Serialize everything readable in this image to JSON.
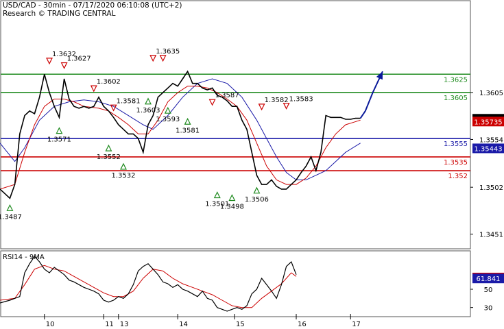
{
  "header": {
    "line1": "USD/CAD - 30min - 07/17/2020 06:10:08 (UTC+2)",
    "line2": "Research © TRADING CENTRAL"
  },
  "colors": {
    "price": "#000000",
    "ma_fast": "#cc0000",
    "ma_slow": "#1a1aa8",
    "support_green": "#1e8a1e",
    "level_blue": "#1a1aa8",
    "level_red": "#cc0000",
    "forecast_arrow": "#0a1a9a",
    "triangle_up": "#1e8a1e",
    "triangle_down": "#cc0000",
    "rsi_line": "#000000",
    "rsi_ma": "#cc0000"
  },
  "chart_data": [
    {
      "type": "line",
      "ylim": [
        1.3435,
        1.3705
      ],
      "y_ticks": [
        {
          "value": 1.3605,
          "label": "1.3605"
        },
        {
          "value": 1.3554,
          "label": "1.3554"
        },
        {
          "value": 1.3502,
          "label": "1.3502"
        },
        {
          "value": 1.3451,
          "label": "1.3451"
        }
      ],
      "x_ticks": [
        {
          "x": 18,
          "label": "10"
        },
        {
          "x": 42,
          "label": "11"
        },
        {
          "x": 48,
          "label": "13"
        },
        {
          "x": 72,
          "label": "14"
        },
        {
          "x": 95,
          "label": "15"
        },
        {
          "x": 120,
          "label": "16"
        },
        {
          "x": 142,
          "label": "17"
        }
      ],
      "xlim": [
        0,
        170
      ],
      "levels": [
        {
          "value": 1.3625,
          "label": "1.3625",
          "color": "#1e8a1e"
        },
        {
          "value": 1.3605,
          "label": "1.3605",
          "color": "#1e8a1e"
        },
        {
          "value": 1.3555,
          "label": "1.3555",
          "color": "#1a1aa8"
        },
        {
          "value": 1.3535,
          "label": "1.3535",
          "color": "#cc0000"
        },
        {
          "value": 1.352,
          "label": "1.352",
          "color": "#cc0000"
        }
      ],
      "price_tags": [
        {
          "value": 1.35765,
          "label": "1.35765",
          "bg": "#000000",
          "fg": "#ffffff"
        },
        {
          "value": 1.35735,
          "label": "1.35735",
          "bg": "#cc0000",
          "fg": "#ffffff"
        },
        {
          "value": 1.35443,
          "label": "1.35443",
          "bg": "#1a1aa8",
          "fg": "#ffffff"
        }
      ],
      "price_series": {
        "x": [
          0,
          2,
          4,
          6,
          8,
          10,
          12,
          14,
          16,
          18,
          20,
          22,
          24,
          26,
          28,
          30,
          32,
          34,
          36,
          38,
          40,
          42,
          44,
          46,
          48,
          50,
          52,
          54,
          56,
          58,
          60,
          62,
          64,
          66,
          68,
          70,
          72,
          74,
          76,
          78,
          80,
          82,
          84,
          86,
          88,
          90,
          92,
          94,
          96,
          98,
          100,
          102,
          104,
          106,
          108,
          110,
          112,
          114,
          116,
          118,
          120,
          122,
          124,
          126,
          128,
          130,
          132,
          134,
          136,
          138,
          140,
          142,
          144,
          146
        ],
        "y": [
          1.35,
          1.3495,
          1.349,
          1.3505,
          1.356,
          1.358,
          1.3585,
          1.3582,
          1.36,
          1.3625,
          1.3605,
          1.359,
          1.3578,
          1.362,
          1.3598,
          1.359,
          1.3588,
          1.359,
          1.3588,
          1.359,
          1.36,
          1.359,
          1.3585,
          1.3578,
          1.357,
          1.3565,
          1.356,
          1.356,
          1.3555,
          1.354,
          1.357,
          1.358,
          1.36,
          1.3605,
          1.361,
          1.3615,
          1.3612,
          1.362,
          1.3628,
          1.3615,
          1.3615,
          1.361,
          1.3608,
          1.361,
          1.3602,
          1.36,
          1.3596,
          1.359,
          1.359,
          1.3575,
          1.3565,
          1.354,
          1.3515,
          1.3505,
          1.3505,
          1.351,
          1.3503,
          1.35,
          1.35,
          1.3505,
          1.351,
          1.3518,
          1.3525,
          1.3535,
          1.352,
          1.354,
          1.358,
          1.3578,
          1.3578,
          1.3578,
          1.3576,
          1.3576,
          1.3577,
          1.3577
        ]
      },
      "ma_fast_series": {
        "name": "",
        "x": [
          0,
          6,
          10,
          14,
          18,
          22,
          26,
          30,
          34,
          40,
          44,
          48,
          52,
          56,
          60,
          64,
          68,
          72,
          76,
          80,
          84,
          88,
          92,
          96,
          100,
          104,
          108,
          112,
          116,
          120,
          124,
          128,
          132,
          136,
          140,
          146
        ],
        "y": [
          1.35,
          1.3505,
          1.354,
          1.357,
          1.359,
          1.3598,
          1.3598,
          1.3595,
          1.359,
          1.3588,
          1.3585,
          1.3578,
          1.357,
          1.356,
          1.356,
          1.3575,
          1.3595,
          1.3605,
          1.3612,
          1.3612,
          1.361,
          1.3605,
          1.3598,
          1.359,
          1.3575,
          1.355,
          1.3525,
          1.351,
          1.3505,
          1.3505,
          1.3512,
          1.3525,
          1.3545,
          1.356,
          1.357,
          1.3575
        ]
      },
      "ma_slow_series": {
        "name": "",
        "x": [
          0,
          6,
          10,
          16,
          22,
          28,
          34,
          40,
          46,
          52,
          58,
          62,
          68,
          74,
          80,
          86,
          92,
          98,
          104,
          108,
          112,
          116,
          120,
          124,
          128,
          132,
          136,
          140,
          146
        ],
        "y": [
          1.355,
          1.353,
          1.3545,
          1.3575,
          1.359,
          1.3595,
          1.3597,
          1.3595,
          1.359,
          1.358,
          1.357,
          1.3565,
          1.358,
          1.36,
          1.3615,
          1.362,
          1.3615,
          1.36,
          1.3575,
          1.3555,
          1.3535,
          1.3518,
          1.351,
          1.351,
          1.3515,
          1.352,
          1.353,
          1.354,
          1.355
        ]
      },
      "forecast_arrow": {
        "x": [
          146,
          148,
          151,
          155
        ],
        "y": [
          1.3577,
          1.3585,
          1.3605,
          1.3628
        ]
      },
      "annotations": [
        {
          "x": 4,
          "value": 1.3487,
          "label": "1.3487",
          "dir": "up"
        },
        {
          "x": 20,
          "value": 1.3632,
          "label": "1.3632",
          "dir": "down"
        },
        {
          "x": 26,
          "value": 1.3627,
          "label": "1.3627",
          "dir": "down"
        },
        {
          "x": 24,
          "value": 1.3571,
          "label": "1.3571",
          "dir": "up"
        },
        {
          "x": 38,
          "value": 1.3602,
          "label": "1.3602",
          "dir": "down"
        },
        {
          "x": 46,
          "value": 1.3581,
          "label": "1.3581",
          "dir": "down"
        },
        {
          "x": 44,
          "value": 1.3552,
          "label": "1.3552",
          "dir": "up"
        },
        {
          "x": 50,
          "value": 1.3532,
          "label": "1.3532",
          "dir": "up"
        },
        {
          "x": 62,
          "value": 1.3635,
          "label": "1.3635",
          "dir": "down"
        },
        {
          "x": 66,
          "value": 1.3635,
          "label": "",
          "dir": "down"
        },
        {
          "x": 60,
          "value": 1.3603,
          "label": "1.3603",
          "dir": "up"
        },
        {
          "x": 68,
          "value": 1.3593,
          "label": "1.3593",
          "dir": "up"
        },
        {
          "x": 76,
          "value": 1.3581,
          "label": "1.3581",
          "dir": "up"
        },
        {
          "x": 86,
          "value": 1.3587,
          "label": "1.3587",
          "dir": "down"
        },
        {
          "x": 88,
          "value": 1.3501,
          "label": "1.3501",
          "dir": "up"
        },
        {
          "x": 94,
          "value": 1.3498,
          "label": "1.3498",
          "dir": "up"
        },
        {
          "x": 104,
          "value": 1.3506,
          "label": "1.3506",
          "dir": "up"
        },
        {
          "x": 106,
          "value": 1.3582,
          "label": "1.3582",
          "dir": "down"
        },
        {
          "x": 116,
          "value": 1.3583,
          "label": "1.3583",
          "dir": "down"
        }
      ]
    },
    {
      "type": "line",
      "title": "RSI14 - 9MA",
      "ylim": [
        20,
        92
      ],
      "y_ticks": [
        {
          "value": 50,
          "label": "50"
        },
        {
          "value": 30,
          "label": "30"
        }
      ],
      "price_tags": [
        {
          "value": 62.8208,
          "label": "62.8208",
          "bg": "#cc0000",
          "fg": "#ffffff"
        },
        {
          "value": 61.841,
          "label": "61.841",
          "bg": "#1a1aa8",
          "fg": "#ffffff"
        }
      ],
      "rsi_series": {
        "x": [
          0,
          4,
          8,
          10,
          12,
          14,
          16,
          18,
          20,
          22,
          24,
          26,
          28,
          30,
          32,
          34,
          36,
          38,
          40,
          42,
          44,
          46,
          48,
          50,
          52,
          54,
          56,
          58,
          60,
          62,
          64,
          66,
          68,
          70,
          72,
          74,
          76,
          78,
          80,
          82,
          84,
          86,
          88,
          90,
          92,
          94,
          96,
          98,
          100,
          102,
          104,
          106,
          108,
          110,
          112,
          114,
          116,
          118,
          120
        ],
        "y": [
          35,
          38,
          42,
          68,
          78,
          86,
          80,
          72,
          68,
          74,
          70,
          66,
          60,
          58,
          55,
          52,
          50,
          48,
          45,
          38,
          36,
          38,
          42,
          40,
          45,
          55,
          70,
          75,
          78,
          72,
          66,
          58,
          56,
          52,
          55,
          50,
          48,
          45,
          42,
          48,
          40,
          38,
          30,
          28,
          26,
          28,
          30,
          28,
          32,
          45,
          50,
          62,
          55,
          48,
          40,
          55,
          75,
          80,
          66
        ]
      },
      "rsi_ma_series": {
        "x": [
          0,
          6,
          10,
          14,
          18,
          22,
          26,
          30,
          34,
          38,
          42,
          46,
          50,
          54,
          58,
          62,
          66,
          70,
          74,
          78,
          82,
          86,
          90,
          94,
          98,
          102,
          106,
          110,
          114,
          118,
          120
        ],
        "y": [
          38,
          40,
          55,
          72,
          76,
          72,
          70,
          64,
          58,
          52,
          46,
          42,
          42,
          48,
          62,
          72,
          70,
          62,
          56,
          52,
          48,
          44,
          38,
          32,
          30,
          30,
          40,
          48,
          56,
          68,
          64
        ]
      }
    }
  ]
}
